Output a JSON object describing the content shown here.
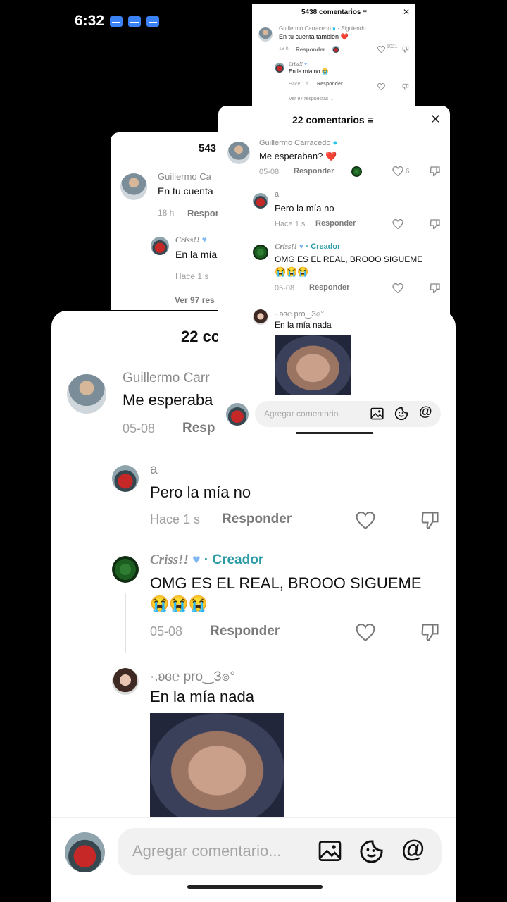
{
  "status_bar": {
    "time": "6:32"
  },
  "panel_top": {
    "title": "5438 comentarios",
    "comment1": {
      "name": "Guillermo Carracedo",
      "following": "· Siguiendo",
      "text": "En tu cuenta también",
      "emoji": "❤️",
      "time": "18 h",
      "reply": "Responder",
      "likes": "5021"
    },
    "reply1": {
      "name": "Criss!!",
      "text": "En la mia no",
      "emoji": "😭",
      "time": "Hace 1 s",
      "reply": "Responder"
    },
    "view_more": "Ver 97 respuestas"
  },
  "panel_back": {
    "title": "543",
    "comment1": {
      "name": "Guillermo Ca",
      "text": "En tu cuenta",
      "time": "18 h",
      "reply": "Respor"
    },
    "reply1": {
      "name": "Criss!!",
      "text": "En la mía",
      "time": "Hace 1 s"
    },
    "view_more": "Ver 97 res"
  },
  "panel_mid": {
    "title": "22 comentarios",
    "comments": {
      "guillermo": {
        "name": "Guillermo Carracedo",
        "text": "Me esperaban?",
        "emoji": "❤️",
        "date": "05-08",
        "reply": "Responder",
        "likes": "6"
      },
      "a": {
        "name": "a",
        "text": "Pero la mía no",
        "time": "Hace 1 s",
        "reply": "Responder"
      },
      "criss": {
        "name": "Criss!!",
        "sep": "·",
        "creator": "Creador",
        "text": "OMG ES EL REAL, BROOO SIGUEME",
        "emojis": "😭😭😭",
        "date": "05-08",
        "reply": "Responder"
      },
      "pro": {
        "name": "·.ʚɞ℮ pro‿З๏°",
        "text": "En la mía nada"
      }
    },
    "input_placeholder": "Agregar comentario..."
  },
  "panel_main": {
    "title": "22 cc",
    "comments": {
      "guillermo": {
        "name": "Guillermo Carr",
        "text": "Me esperaba",
        "date": "05-08",
        "reply": "Resp"
      },
      "a": {
        "name": "a",
        "text": "Pero la mía no",
        "time": "Hace 1 s",
        "reply": "Responder"
      },
      "criss": {
        "name": "Criss!!",
        "sep": "·",
        "creator": "Creador",
        "text": "OMG ES EL REAL, BROOO SIGUEME",
        "emojis": "😭😭😭",
        "date": "05-08",
        "reply": "Responder"
      },
      "pro": {
        "name": "·.ʚɞ℮ pro‿З๏°",
        "text": "En la mía nada"
      }
    },
    "input_placeholder": "Agregar comentario..."
  },
  "icons": {
    "heart": "heart-icon",
    "dislike": "dislike-icon",
    "image": "image-icon",
    "sticker": "sticker-icon",
    "mention": "at-icon",
    "filter": "filter-icon",
    "close": "close-icon"
  },
  "colors": {
    "creator": "#2a9aa5",
    "verified": "#20c4e8",
    "heart_red": "#e6194b"
  }
}
